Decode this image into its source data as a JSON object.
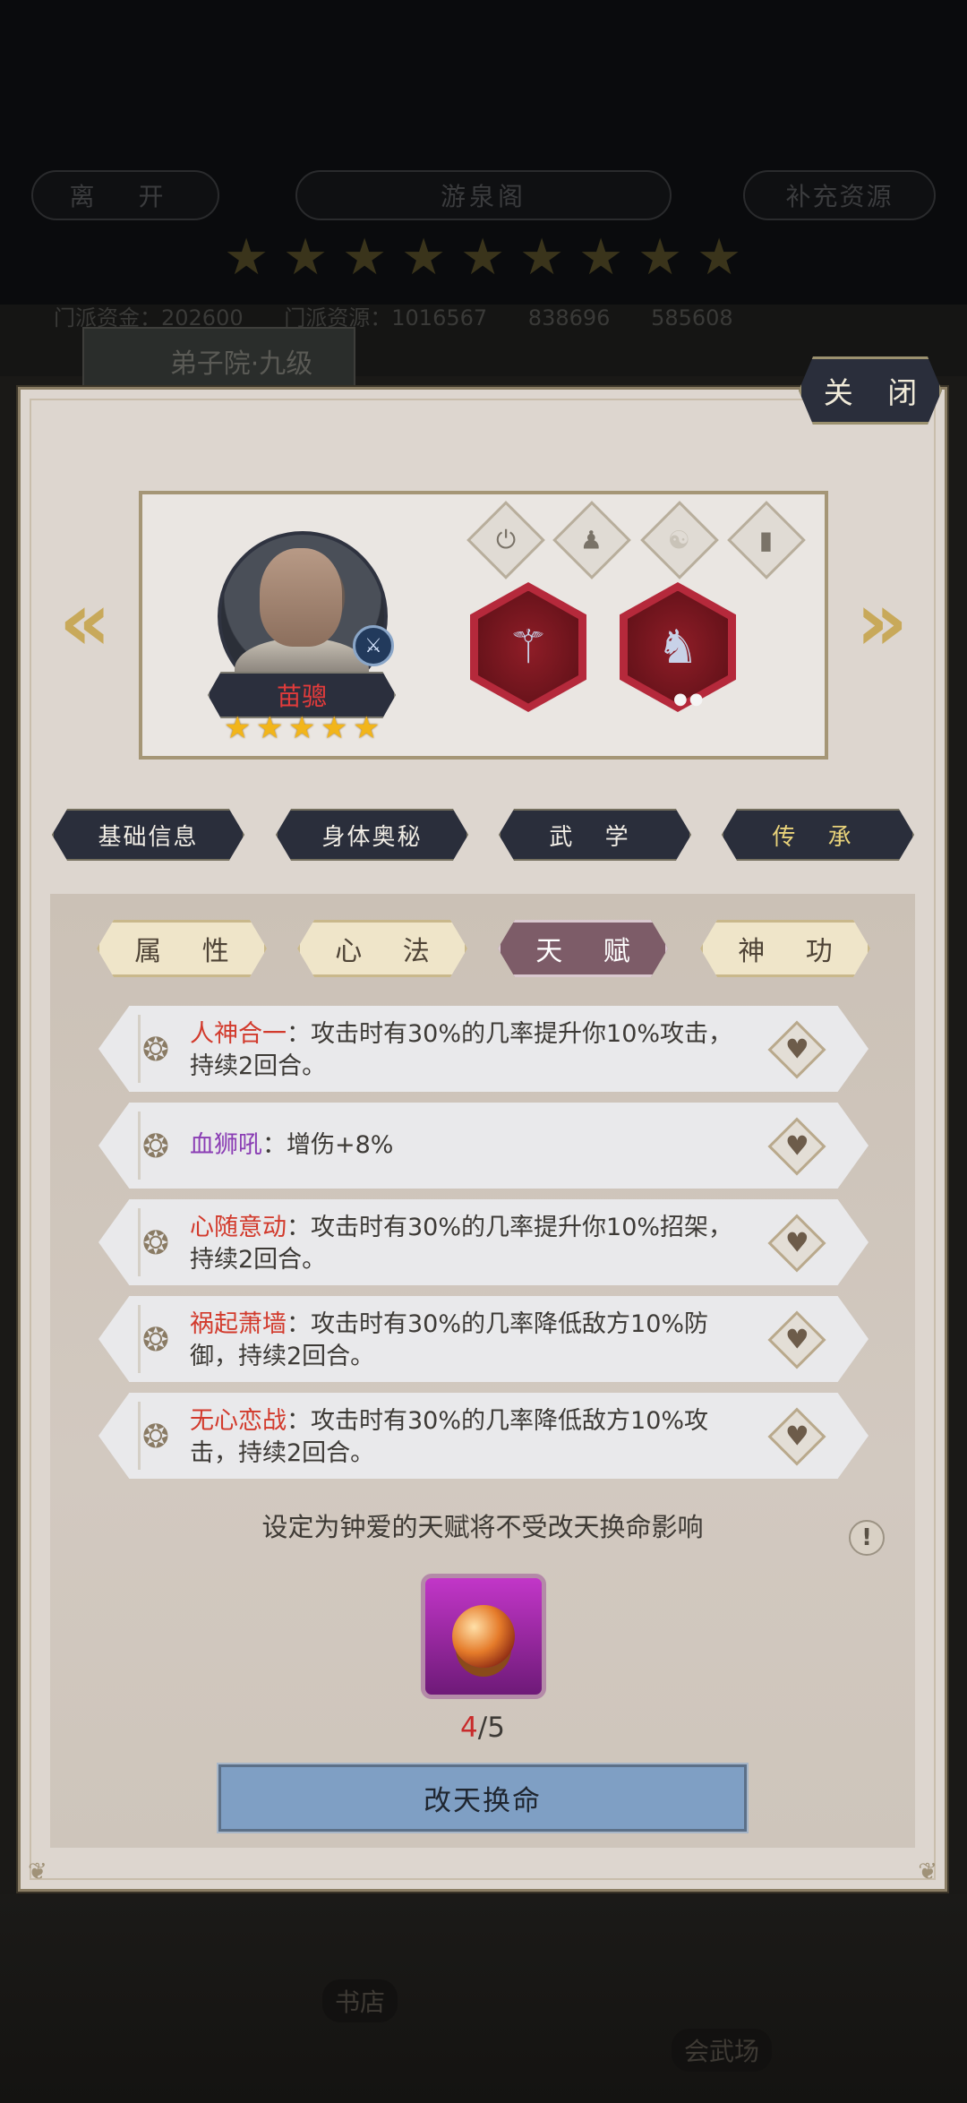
{
  "background": {
    "buttons": [
      "离 开",
      "游泉阁",
      "补充资源"
    ],
    "resources": [
      "门派资金：202600",
      "门派资源：1016567",
      "838696",
      "585608"
    ],
    "banner": "弟子院·九级",
    "bottom_labels": [
      "书店",
      "会武场"
    ]
  },
  "panel": {
    "close_label": "关 闭"
  },
  "hero": {
    "name": "苗骢",
    "star_count": 5
  },
  "main_tabs": [
    "基础信息",
    "身体奥秘",
    "武 学",
    "传 承"
  ],
  "sub_tabs": [
    "属 性",
    "心 法",
    "天 赋",
    "神 功"
  ],
  "talents": [
    {
      "name": "人神合一",
      "name_color": "#d23a2c",
      "desc": "：攻击时有30%的几率提升你10%攻击，持续2回合。"
    },
    {
      "name": "血狮吼",
      "name_color": "#8a3db4",
      "desc": "：增伤+8%"
    },
    {
      "name": "心随意动",
      "name_color": "#d23a2c",
      "desc": "：攻击时有30%的几率提升你10%招架，持续2回合。"
    },
    {
      "name": "祸起萧墙",
      "name_color": "#d23a2c",
      "desc": "：攻击时有30%的几率降低敌方10%防御，持续2回合。"
    },
    {
      "name": "无心恋战",
      "name_color": "#d23a2c",
      "desc": "：攻击时有30%的几率降低敌方10%攻击，持续2回合。"
    }
  ],
  "hint": "设定为钟爱的天赋将不受改天换命影响",
  "item": {
    "count_current": "4",
    "count_sep": "/5"
  },
  "change_button": "改天换命"
}
